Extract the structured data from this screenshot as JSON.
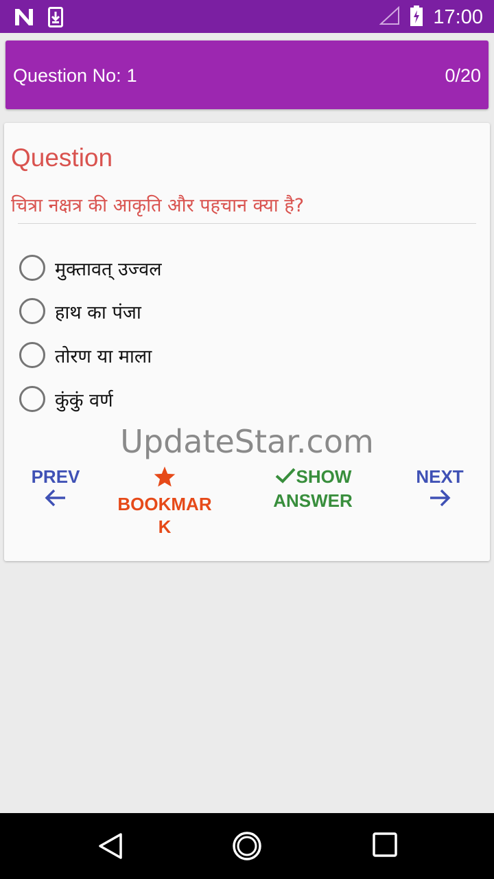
{
  "status_bar": {
    "time": "17:00",
    "icons": [
      "notification-n-icon",
      "download-icon",
      "signal-icon",
      "battery-charging-icon"
    ]
  },
  "header": {
    "question_label": "Question No:",
    "question_number": "1",
    "progress": "0/20"
  },
  "card": {
    "title": "Question",
    "question": "चित्रा नक्षत्र की आकृति और पहचान क्या है?",
    "options": [
      {
        "label": "मुक्तावत् उज्वल"
      },
      {
        "label": "हाथ का पंजा"
      },
      {
        "label": "तोरण या माला"
      },
      {
        "label": "कुंकुं वर्ण"
      }
    ],
    "watermark": "UpdateStar.com"
  },
  "actions": {
    "prev_label": "PREV",
    "bookmark_label_line1": "BOOKMAR",
    "bookmark_label_line2": "K",
    "show_answer_line1": "SHOW",
    "show_answer_line2": "ANSWER",
    "next_label": "NEXT"
  },
  "colors": {
    "status_bar": "#7b1fa2",
    "header": "#9c27b0",
    "question_red": "#d9534f",
    "nav_blue": "#3f51b5",
    "bookmark_orange": "#e64a19",
    "show_green": "#388e3c"
  },
  "nav_bar": {
    "icons": [
      "back-icon",
      "home-icon",
      "recents-icon"
    ]
  }
}
